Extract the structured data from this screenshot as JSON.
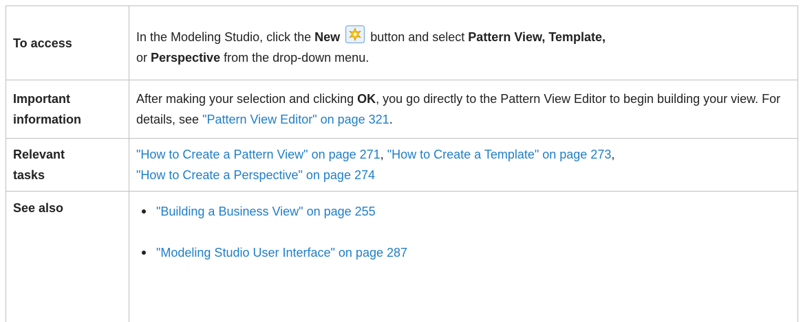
{
  "rows": [
    {
      "label": "To access",
      "parts": {
        "t1": "In the Modeling Studio, click the ",
        "b1": "New",
        "icon": "new-star-icon",
        "t2": " button and select ",
        "b2": "Pattern View, Template,",
        "t3": " or ",
        "b3": "Perspective",
        "t4": " from the drop-down menu."
      }
    },
    {
      "label": "Important information",
      "label_line1": "Important",
      "label_line2": "information",
      "parts": {
        "t1": "After making your selection and clicking ",
        "b1": "OK",
        "t2": ", you go directly to the Pattern View Editor to begin building your view. For details, see ",
        "link1": "\"Pattern View Editor\" on page 321",
        "t3": "."
      }
    },
    {
      "label": "Relevant tasks",
      "label_line1": "Relevant",
      "label_line2": "tasks",
      "links": [
        "\"How to Create a Pattern View\" on page 271",
        "\"How to Create a Template\" on page 273",
        "\"How to Create a Perspective\" on page 274"
      ],
      "sep": ", ",
      "sep_end": ","
    },
    {
      "label": "See also",
      "links": [
        "\"Building a Business View\" on page 255",
        "\"Modeling Studio User Interface\" on page 287"
      ]
    }
  ],
  "colors": {
    "text": "#222222",
    "link": "#1f7ec9",
    "border": "#bfbfbf",
    "icon_bg": "#cfe3f4",
    "icon_star": "#f5c518"
  }
}
